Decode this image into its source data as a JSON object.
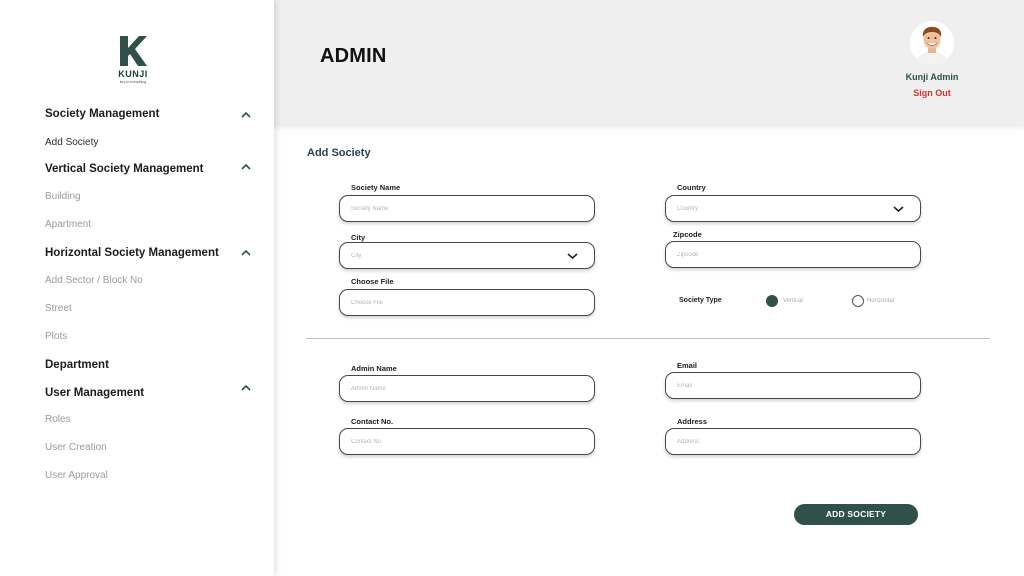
{
  "brand": {
    "name": "KUNJI",
    "tagline": "key to everything",
    "color": "#2f5149"
  },
  "sidebar": {
    "sections": [
      {
        "title": "Society Management",
        "items": [
          "Add Society"
        ]
      },
      {
        "title": "Vertical Society Management",
        "items": [
          "Building",
          "Apartment"
        ]
      },
      {
        "title": "Horizontal Society Management",
        "items": [
          "Add Sector / Block No",
          "Street",
          "Plots"
        ]
      },
      {
        "title": "Department",
        "items": []
      },
      {
        "title": "User Management",
        "items": [
          "Roles",
          "User Creation",
          "User Approval"
        ]
      }
    ],
    "active_item": "Add Society"
  },
  "header": {
    "title": "ADMIN",
    "user_name": "Kunji Admin",
    "sign_out": "Sign Out"
  },
  "form": {
    "title": "Add Society",
    "society_name": {
      "label": "Society Name",
      "placeholder": "Society Name"
    },
    "country": {
      "label": "Country",
      "placeholder": "Country"
    },
    "city": {
      "label": "City",
      "placeholder": "City"
    },
    "zipcode": {
      "label": "Zipcode",
      "placeholder": "Zipcode"
    },
    "choose_file": {
      "label": "Choose File",
      "placeholder": "Choose File"
    },
    "society_type": {
      "label": "Society Type",
      "options": [
        "Vertical",
        "Horizontal"
      ],
      "selected": "Vertical"
    },
    "admin_name": {
      "label": "Admin Name",
      "placeholder": "Admin Name"
    },
    "email": {
      "label": "Email",
      "placeholder": "Email"
    },
    "contact": {
      "label": "Contact No.",
      "placeholder": "Contact No."
    },
    "address": {
      "label": "Address",
      "placeholder": "Address"
    },
    "submit": "ADD SOCIETY"
  }
}
